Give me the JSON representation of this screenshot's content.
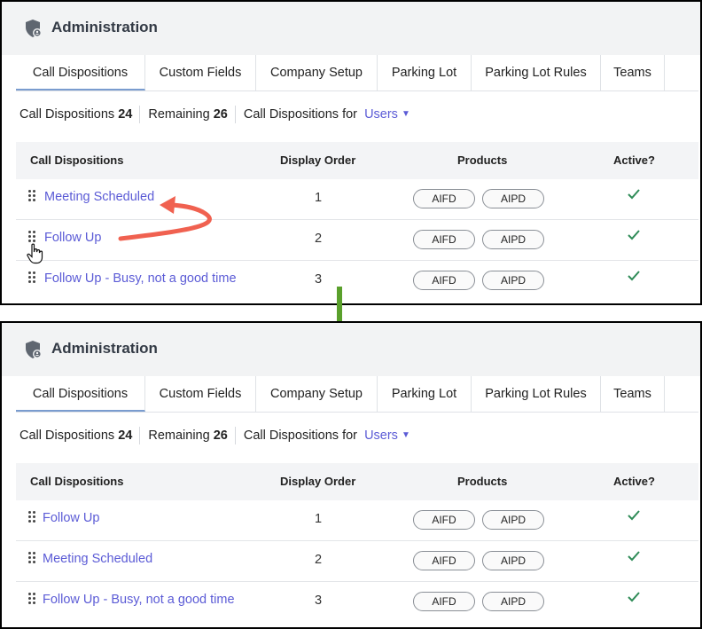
{
  "header": {
    "title": "Administration"
  },
  "tabs": [
    {
      "label": "Call Dispositions",
      "active": true
    },
    {
      "label": "Custom Fields"
    },
    {
      "label": "Company Setup"
    },
    {
      "label": "Parking Lot"
    },
    {
      "label": "Parking Lot Rules"
    },
    {
      "label": "Teams"
    }
  ],
  "summary": {
    "count_label": "Call Dispositions",
    "count_value": "24",
    "remaining_label": "Remaining",
    "remaining_value": "26",
    "filter_label": "Call Dispositions for",
    "filter_value": "Users"
  },
  "table": {
    "columns": [
      "Call Dispositions",
      "Display Order",
      "Products",
      "Active?"
    ]
  },
  "before": {
    "rows": [
      {
        "name": "Meeting Scheduled",
        "order": "1",
        "products": [
          "AIFD",
          "AIPD"
        ]
      },
      {
        "name": "Follow Up",
        "order": "2",
        "products": [
          "AIFD",
          "AIPD"
        ]
      },
      {
        "name": "Follow Up - Busy, not a good time",
        "order": "3",
        "products": [
          "AIFD",
          "AIPD"
        ]
      }
    ]
  },
  "after": {
    "rows": [
      {
        "name": "Follow Up",
        "order": "1",
        "products": [
          "AIFD",
          "AIPD"
        ]
      },
      {
        "name": "Meeting Scheduled",
        "order": "2",
        "products": [
          "AIFD",
          "AIPD"
        ]
      },
      {
        "name": "Follow Up - Busy, not a good time",
        "order": "3",
        "products": [
          "AIFD",
          "AIPD"
        ]
      }
    ]
  },
  "colors": {
    "link": "#5b5bd6",
    "check": "#2e8b57",
    "drag_arrow": "#f06150",
    "transition_arrow": "#5aa02c",
    "tab_underline": "#7a9ccf"
  },
  "icons": [
    "shield-user-icon",
    "drag-handle-icon",
    "check-icon",
    "caret-down-icon",
    "hand-cursor-icon"
  ]
}
